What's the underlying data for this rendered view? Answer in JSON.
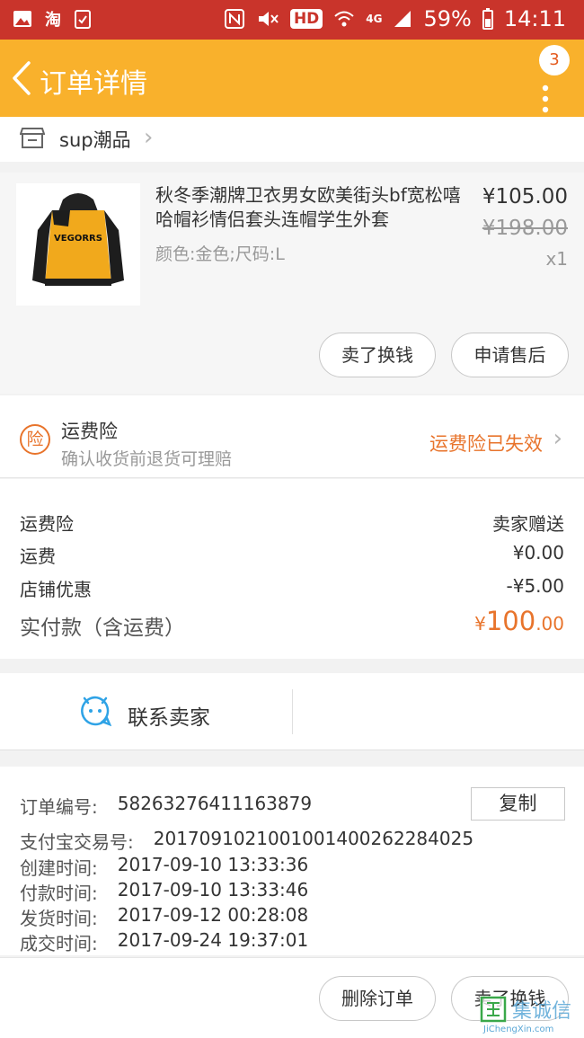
{
  "status_bar": {
    "battery": "59%",
    "time": "14:11",
    "hd_label": "HD",
    "network_label": "4G",
    "app_icons": [
      "gallery-icon",
      "taobao-icon",
      "clipboard-check-icon"
    ],
    "system_icons": [
      "nfc-icon",
      "mute-icon",
      "wifi-icon",
      "signal-icon",
      "battery-icon"
    ]
  },
  "header": {
    "title": "订单详情",
    "badge_count": "3"
  },
  "shop": {
    "name": "sup潮品"
  },
  "product": {
    "title": "秋冬季潮牌卫衣男女欧美街头bf宽松嘻哈帽衫情侣套头连帽学生外套",
    "attrs": "颜色:金色;尺码:L",
    "price": "¥105.00",
    "original_price": "¥198.00",
    "quantity": "x1",
    "image_text": "VEGORRS",
    "actions": [
      "卖了换钱",
      "申请售后"
    ]
  },
  "insurance": {
    "icon_text": "险",
    "title": "运费险",
    "subtitle": "确认收货前退货可理赔",
    "status": "运费险已失效"
  },
  "fees": [
    {
      "label": "运费险",
      "value": "卖家赠送"
    },
    {
      "label": "运费",
      "value": "¥0.00"
    },
    {
      "label": "店铺优惠",
      "value": "-¥5.00"
    }
  ],
  "total": {
    "label": "实付款（含运费）",
    "currency": "¥",
    "integer": "100",
    "decimal": ".00"
  },
  "contact": {
    "label": "联系卖家"
  },
  "order_info": {
    "copy_label": "复制",
    "rows": [
      {
        "label": "订单编号:",
        "value": "58263276411163879"
      },
      {
        "label": "支付宝交易号:",
        "value": "2017091021001001400262284025"
      },
      {
        "label": "创建时间:",
        "value": "2017-09-10 13:33:36"
      },
      {
        "label": "付款时间:",
        "value": "2017-09-10 13:33:46"
      },
      {
        "label": "发货时间:",
        "value": "2017-09-12 00:28:08"
      },
      {
        "label": "成交时间:",
        "value": "2017-09-24 19:37:01"
      }
    ]
  },
  "bottom_actions": [
    "删除订单",
    "卖了换钱"
  ],
  "watermark": {
    "text": "JiChengXin.com",
    "logo_text": "集诚信"
  },
  "colors": {
    "status_bar": "#c9342b",
    "header": "#f9b12c",
    "accent_orange": "#e8742c"
  }
}
